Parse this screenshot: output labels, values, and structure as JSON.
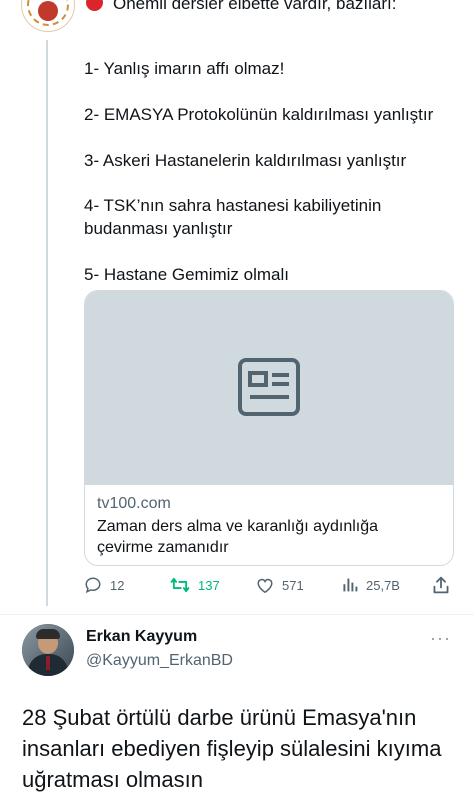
{
  "thread": {
    "first_line": "Önemli dersler elbette vardır, bazıları:",
    "items": [
      "1- Yanlış imarın affı olmaz!",
      "2- EMASYA Protokolünün kaldırılması yanlıştır",
      "3- Askeri Hastanelerin kaldırılması yanlıştır",
      "4- TSK’nın sahra hastanesi kabiliyetinin budanması yanlıştır",
      "5- Hastane Gemimiz olmalı"
    ]
  },
  "card": {
    "domain": "tv100.com",
    "title": "Zaman ders alma ve karanlığı aydınlığa çevirme zamanıdır",
    "icon": "news-article-icon"
  },
  "actions": {
    "replies": "12",
    "retweets": "137",
    "likes": "571",
    "views": "25,7B"
  },
  "reply": {
    "name": "Erkan Kayyum",
    "handle": "@Kayyum_ErkanBD",
    "more": "···",
    "text": "28 Şubat örtülü darbe ürünü Emasya'nın insanları ebediyen fişleyip sülalesini kıyıma uğratması olmasın"
  },
  "colors": {
    "retweet_accent": "#00ba7c",
    "muted": "#536471",
    "card_media": "#cfd9de"
  }
}
